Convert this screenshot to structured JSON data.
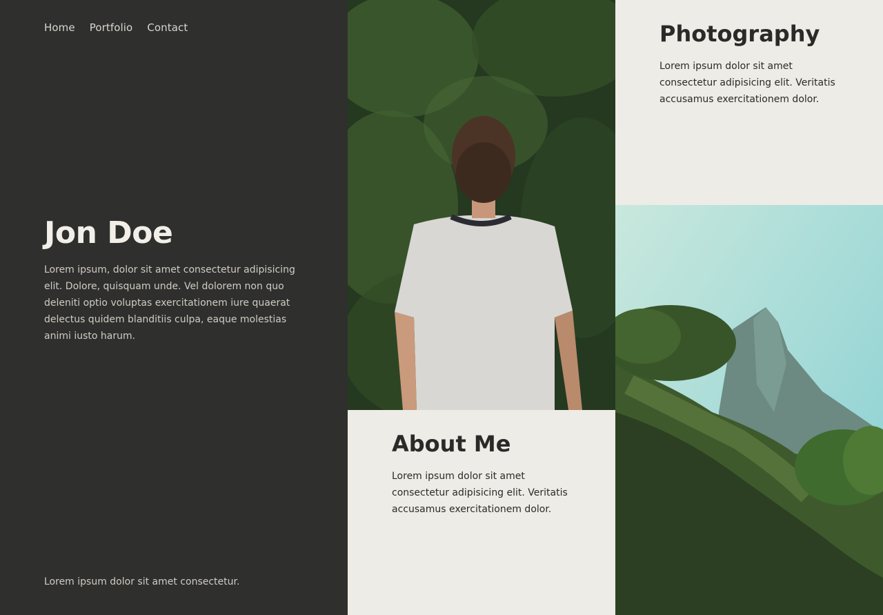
{
  "nav": {
    "items": [
      "Home",
      "Portfolio",
      "Contact"
    ]
  },
  "hero": {
    "title": "Jon Doe",
    "text": "Lorem ipsum, dolor sit amet consectetur adipisicing elit. Dolore, quisquam unde. Vel dolorem non quo deleniti optio voluptas exercitationem iure quaerat delectus quidem blanditiis culpa, eaque molestias animi iusto harum."
  },
  "footer": {
    "text": "Lorem ipsum dolor sit amet consectetur."
  },
  "about": {
    "title": "About Me",
    "text": "Lorem ipsum dolor sit amet consectetur adipisicing elit. Veritatis accusamus exercitationem dolor."
  },
  "photography": {
    "title": "Photography",
    "text": "Lorem ipsum dolor sit amet consectetur adipisicing elit. Veritatis accusamus exercitationem dolor."
  },
  "colors": {
    "dark_panel": "#2f2f2d",
    "light_panel": "#edece6",
    "heading": "#2a2a28"
  }
}
